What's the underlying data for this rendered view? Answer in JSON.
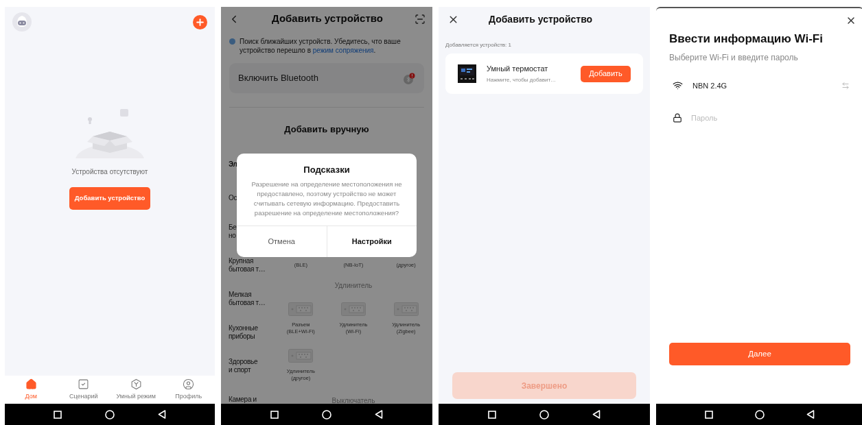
{
  "home": {
    "empty_text": "Устройства отсутствуют",
    "add_button": "Добавить устройство",
    "bottom_tabs": [
      {
        "label": "Дом",
        "kind": "home",
        "selected": true
      },
      {
        "label": "Сценарий",
        "kind": "scene",
        "selected": false
      },
      {
        "label": "Умный режим",
        "kind": "smart",
        "selected": false
      },
      {
        "label": "Профиль",
        "kind": "profile",
        "selected": false
      }
    ]
  },
  "add_device": {
    "title": "Добавить устройство",
    "hint": "Поиск ближайших устройств. Убедитесь, что ваше устройство перешло в ",
    "hint_link": "режим сопряжения",
    "hint_end": ".",
    "bluetooth_label": "Включить Bluetooth",
    "manual_title": "Добавить вручную",
    "categories": [
      "Эл",
      "Ос",
      "Бе\nно",
      "Крупная\nбытовая т…",
      "Мелкая\nбытовая т…",
      "Кухонные\nприборы",
      "Здоровье\nи спорт",
      "Камера и"
    ],
    "partial_labels": [
      "(BLE)",
      "(NB-IoT)",
      "(другое)"
    ],
    "sections": [
      {
        "title": "Удлинитель",
        "products": [
          {
            "name": "Разъем\n(BLE+Wi-Fi)"
          },
          {
            "name": "Удлинитель\n(Wi-Fi)"
          },
          {
            "name": "Удлинитель\n(Zigbee)"
          },
          {
            "name": "Удлинитель\n(другое)"
          }
        ]
      },
      {
        "title": "Выключатель"
      }
    ],
    "dialog": {
      "title": "Подсказки",
      "message": "Разрешение на определение местоположения не предоставлено, поэтому устройство не может считывать сетевую информацию. Предоставить разрешение на определение местоположения?",
      "buttons": [
        {
          "label": "Отмена",
          "primary": false
        },
        {
          "label": "Настройки",
          "primary": true
        }
      ]
    }
  },
  "found": {
    "title": "Добавить устройство",
    "count_text": "Добавляется устройств: 1",
    "devices": [
      {
        "name": "Умный термостат",
        "hint": "Нажмите, чтобы добавит…",
        "button": "Добавить"
      }
    ],
    "done_button": {
      "label": "Завершено",
      "disabled": true
    }
  },
  "wifi": {
    "title": "Ввести информацию Wi-Fi",
    "subtitle": "Выберите Wi-Fi и введите пароль",
    "network": "NBN 2.4G",
    "password_placeholder": "Пароль",
    "next_button": "Далее"
  }
}
